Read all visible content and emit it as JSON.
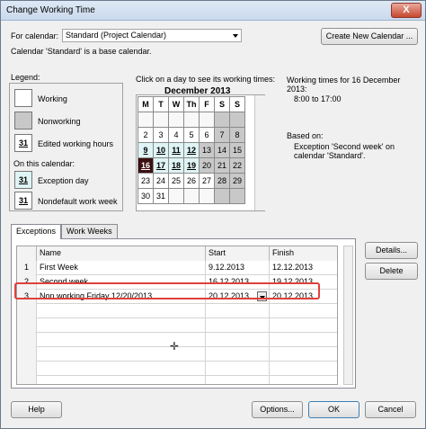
{
  "window": {
    "title": "Change Working Time",
    "close_label": "X"
  },
  "calendar_row": {
    "label": "For calendar:",
    "selected": "Standard (Project Calendar)",
    "create_button": "Create New Calendar ...",
    "base_note": "Calendar 'Standard' is a base calendar."
  },
  "legend": {
    "title": "Legend:",
    "items": [
      "Working",
      "Nonworking",
      "Edited working hours"
    ],
    "edited_num": "31",
    "on_this": "On this calendar:",
    "items2": [
      "Exception day",
      "Nondefault work week"
    ],
    "exc_num": "31",
    "nondef_num": "31"
  },
  "cal": {
    "instruction": "Click on a day to see its working times:",
    "month": "December 2013",
    "days": [
      "M",
      "T",
      "W",
      "Th",
      "F",
      "S",
      "S"
    ],
    "rows": [
      [
        "",
        "",
        "",
        "",
        "",
        "",
        ""
      ],
      [
        "2",
        "3",
        "4",
        "5",
        "6",
        "7",
        "8"
      ],
      [
        "9",
        "10",
        "11",
        "12",
        "13",
        "14",
        "15"
      ],
      [
        "16",
        "17",
        "18",
        "19",
        "20",
        "21",
        "22"
      ],
      [
        "23",
        "24",
        "25",
        "26",
        "27",
        "28",
        "29"
      ],
      [
        "30",
        "31",
        "",
        "",
        "",
        "",
        ""
      ]
    ]
  },
  "info": {
    "working_times": "Working times for 16 December 2013:",
    "time": "8:00 to 17:00",
    "based_on": "Based on:",
    "exception": "Exception 'Second week' on calendar 'Standard'."
  },
  "tabs": {
    "exceptions": "Exceptions",
    "work_weeks": "Work Weeks"
  },
  "table": {
    "headers": [
      "Name",
      "Start",
      "Finish"
    ],
    "rows": [
      {
        "num": "1",
        "name": "First Week",
        "start": "9.12.2013",
        "finish": "12.12.2013"
      },
      {
        "num": "2",
        "name": "Second week",
        "start": "16.12.2013",
        "finish": "19.12.2013"
      },
      {
        "num": "3",
        "name": "Non working Friday 12/20/2013",
        "start": "20.12.2013",
        "finish": "20.12.2013"
      }
    ]
  },
  "buttons": {
    "details": "Details...",
    "delete": "Delete",
    "help": "Help",
    "options": "Options...",
    "ok": "OK",
    "cancel": "Cancel"
  },
  "colors": {
    "highlight": "#e0403c",
    "selected_day": "#3b1010",
    "exception_day": "#dff4f4"
  }
}
